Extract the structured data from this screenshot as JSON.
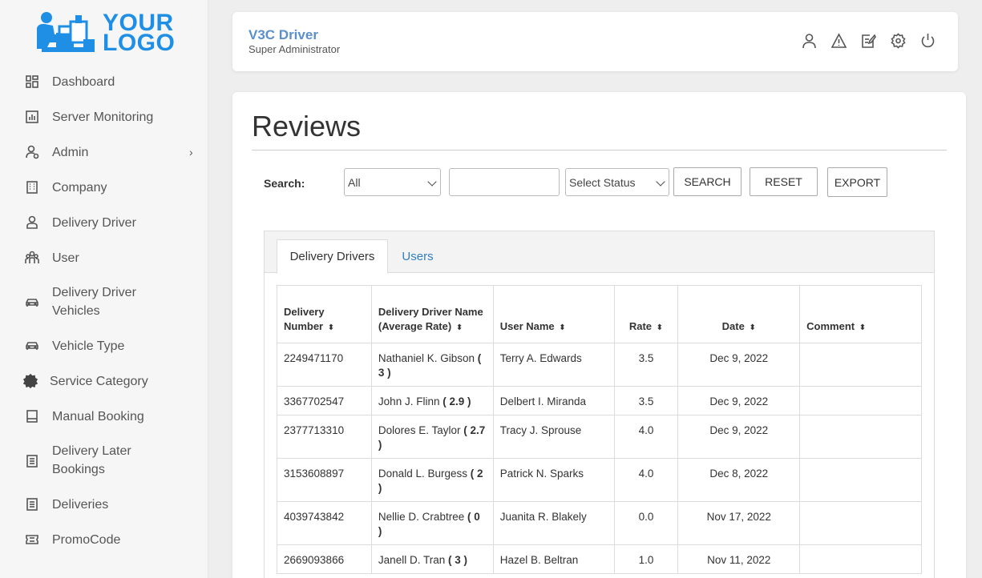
{
  "logo": {
    "line1": "YOUR",
    "line2": "LOGO",
    "color": "#1f8fe5"
  },
  "sidebar": {
    "items": [
      {
        "label": "Dashboard",
        "icon": "dashboard-icon"
      },
      {
        "label": "Server Monitoring",
        "icon": "chart-icon"
      },
      {
        "label": "Admin",
        "icon": "admin-user-icon",
        "arrow": "›"
      },
      {
        "label": "Company",
        "icon": "building-icon"
      },
      {
        "label": "Delivery Driver",
        "icon": "driver-icon"
      },
      {
        "label": "User",
        "icon": "users-icon"
      },
      {
        "label": "Delivery Driver Vehicles",
        "icon": "car-icon"
      },
      {
        "label": "Vehicle Type",
        "icon": "car-icon"
      },
      {
        "label": "Service Category",
        "icon": "gear-badge-icon"
      },
      {
        "label": "Manual Booking",
        "icon": "book-icon"
      },
      {
        "label": "Delivery Later Bookings",
        "icon": "list-icon"
      },
      {
        "label": "Deliveries",
        "icon": "list-icon"
      },
      {
        "label": "PromoCode",
        "icon": "ticket-icon"
      }
    ]
  },
  "header": {
    "title": "V3C Driver",
    "subtitle": "Super Administrator",
    "icons": [
      "user-icon",
      "alert-icon",
      "edit-icon",
      "settings-icon",
      "power-icon"
    ]
  },
  "main": {
    "title": "Reviews",
    "search": {
      "label": "Search:",
      "filter_value": "All",
      "text_value": "",
      "status_value": "Select Status",
      "search_button": "SEARCH",
      "reset_button": "RESET",
      "export_button": "EXPORT"
    },
    "tabs": [
      {
        "label": "Delivery Drivers",
        "active": true
      },
      {
        "label": "Users",
        "active": false
      }
    ],
    "table": {
      "headers": {
        "delivery_number": "Delivery Number",
        "driver_name": "Delivery Driver Name (Average Rate)",
        "user_name": "User Name",
        "rate": "Rate",
        "date": "Date",
        "comment": "Comment",
        "sort_icon": "⬍"
      },
      "rows": [
        {
          "number": "2249471170",
          "driver": "Nathaniel K. Gibson",
          "avg": "( 3 )",
          "user": "Terry A. Edwards",
          "rate": "3.5",
          "date": "Dec 9, 2022",
          "comment": ""
        },
        {
          "number": "3367702547",
          "driver": "John J. Flinn",
          "avg": "( 2.9 )",
          "user": "Delbert I. Miranda",
          "rate": "3.5",
          "date": "Dec 9, 2022",
          "comment": ""
        },
        {
          "number": "2377713310",
          "driver": "Dolores E. Taylor",
          "avg": "( 2.7 )",
          "user": "Tracy J. Sprouse",
          "rate": "4.0",
          "date": "Dec 9, 2022",
          "comment": ""
        },
        {
          "number": "3153608897",
          "driver": "Donald L. Burgess",
          "avg": "( 2 )",
          "user": "Patrick N. Sparks",
          "rate": "4.0",
          "date": "Dec 8, 2022",
          "comment": ""
        },
        {
          "number": "4039743842",
          "driver": "Nellie D. Crabtree",
          "avg": "( 0 )",
          "user": "Juanita R. Blakely",
          "rate": "0.0",
          "date": "Nov 17, 2022",
          "comment": ""
        },
        {
          "number": "2669093866",
          "driver": "Janell D. Tran",
          "avg": "( 3 )",
          "user": "Hazel B. Beltran",
          "rate": "1.0",
          "date": "Nov 11, 2022",
          "comment": ""
        }
      ]
    }
  }
}
